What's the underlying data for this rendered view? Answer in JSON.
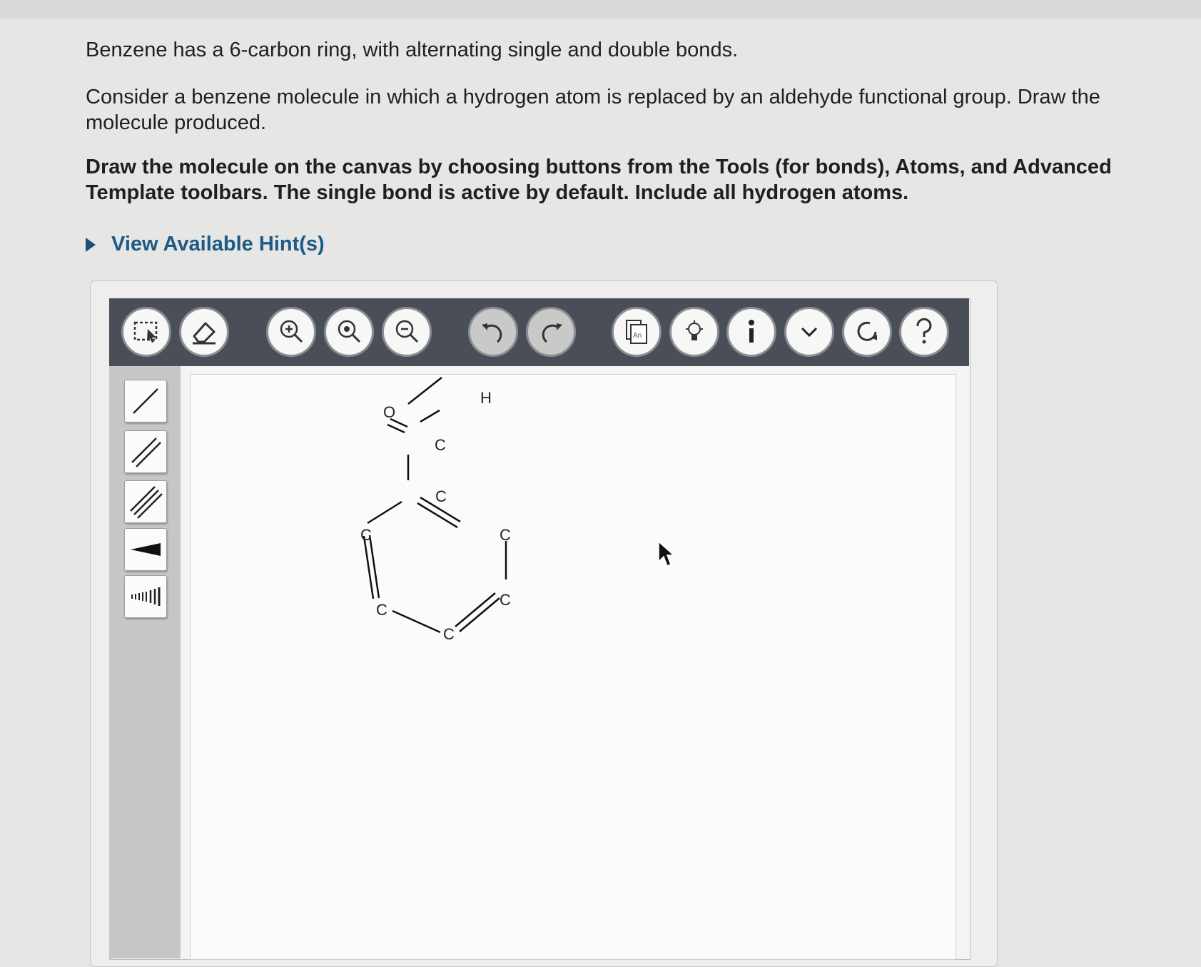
{
  "question": {
    "line1": "Benzene has a 6-carbon ring, with alternating single and double bonds.",
    "line2": "Consider a benzene molecule in which a hydrogen atom is replaced by an aldehyde functional group. Draw the molecule produced.",
    "instructions": "Draw the molecule on the canvas by choosing buttons from the Tools (for bonds), Atoms, and Advanced Template toolbars. The single bond is active by default. Include all hydrogen atoms.",
    "hint_label": "View Available Hint(s)"
  },
  "toolbar": {
    "buttons": [
      "select-tool",
      "erase-tool",
      "zoom-in",
      "zoom-reset",
      "zoom-out",
      "undo",
      "redo",
      "templates",
      "clean",
      "info",
      "expand",
      "reset",
      "help"
    ]
  },
  "bond_tools": [
    "single-bond",
    "double-bond",
    "triple-bond",
    "wedge-bond",
    "hash-bond"
  ],
  "molecule": {
    "atoms": {
      "o": "O",
      "c_carbonyl": "C",
      "h": "H",
      "c1": "C",
      "c2": "C",
      "c3": "C",
      "c4": "C",
      "c5": "C",
      "c6": "C"
    }
  },
  "colors": {
    "hint_link": "#1d5a85",
    "toolbar_bg": "#4a4f57",
    "sidebar_bg": "#c6c6c4"
  }
}
